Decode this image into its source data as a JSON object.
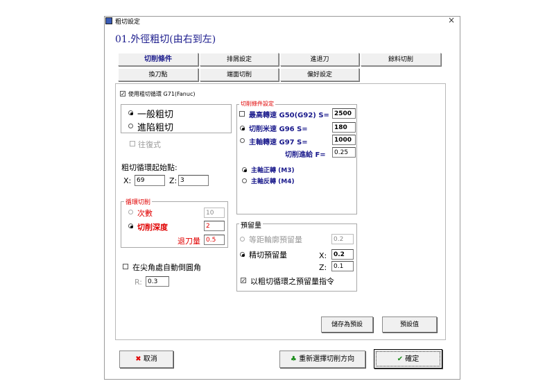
{
  "window": {
    "title": "粗切設定",
    "close": "×"
  },
  "heading": "01.外徑粗切(由右到左)",
  "tabs": [
    "切削條件",
    "排屑設定",
    "進退刀",
    "餘料切削",
    "換刀點",
    "端面切削",
    "偏好設定"
  ],
  "use_cycle": {
    "checked": "✓",
    "label": "使用粗切循環 G71(Fanuc)"
  },
  "mode": {
    "general": "一般粗切",
    "grooving": "進陷粗切"
  },
  "reciprocate": "往復式",
  "start_point": {
    "label": "粗切循環起始點:",
    "x_label": "X:",
    "x_value": "69",
    "z_label": "Z:",
    "z_value": "3"
  },
  "cycle_cut": {
    "title": "循環切削",
    "count_label": "次數",
    "count_value": "10",
    "depth_label": "切削深度",
    "depth_value": "2",
    "retract_label": "退刀量",
    "retract_value": "0.5"
  },
  "chamfer": {
    "label": "在尖角處自動倒圓角",
    "r_label": "R:",
    "r_value": "0.3"
  },
  "cutting": {
    "title": "切削條件設定",
    "max_speed_label": "最高轉速 G50(G92)  S=",
    "max_speed_value": "2500",
    "css_label": "切削米速 G96 S=",
    "css_value": "180",
    "spindle_label": "主軸轉速 G97 S=",
    "spindle_value": "1000",
    "feed_label": "切削進給 F=",
    "feed_value": "0.25",
    "cw": "主軸正轉 (M3)",
    "ccw": "主軸反轉 (M4)"
  },
  "allowance": {
    "title": "預留量",
    "equal_label": "等距輪廓預留量",
    "equal_value": "0.2",
    "finish_label": "精切預留量",
    "finish_x_label": "X:",
    "finish_x_value": "0.2",
    "finish_z_label": "Z:",
    "finish_z_value": "0.1",
    "use_cycle_allowance_check": "✓",
    "use_cycle_allowance": "以粗切循環之預留量指令"
  },
  "panel_buttons": {
    "save_default": "儲存為預設",
    "defaults": "預設值"
  },
  "footer": {
    "cancel_icon": "✖",
    "cancel": "取消",
    "reselect_icon": "♣",
    "reselect": "重新選擇切削方向",
    "ok_icon": "✔",
    "ok": "確定"
  },
  "colors": {
    "accent_red": "#e00000",
    "heading_blue": "#1a1a8c"
  }
}
